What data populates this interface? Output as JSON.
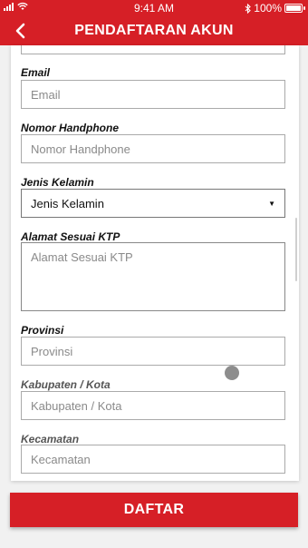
{
  "status_bar": {
    "time": "9:41 AM",
    "battery": "100%"
  },
  "header": {
    "title": "PENDAFTARAN AKUN",
    "back_icon": "chevron-left-icon"
  },
  "form": {
    "email": {
      "label": "Email",
      "placeholder": "Email"
    },
    "phone": {
      "label": "Nomor Handphone",
      "placeholder": "Nomor Handphone"
    },
    "gender": {
      "label": "Jenis Kelamin",
      "selected": "Jenis Kelamin"
    },
    "address": {
      "label": "Alamat Sesuai KTP",
      "placeholder": "Alamat Sesuai KTP"
    },
    "province": {
      "label": "Provinsi",
      "placeholder": "Provinsi"
    },
    "regency": {
      "label": "Kabupaten / Kota",
      "placeholder": "Kabupaten / Kota"
    },
    "district": {
      "label": "Kecamatan",
      "placeholder": "Kecamatan"
    }
  },
  "submit_button": {
    "label": "DAFTAR"
  },
  "colors": {
    "primary": "#d61f26",
    "background": "#f1f1f1"
  }
}
